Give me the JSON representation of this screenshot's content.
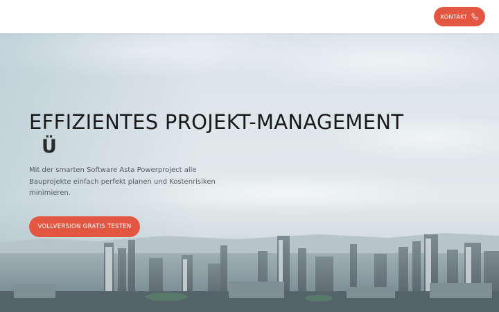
{
  "header": {
    "contact_label": "KONTAKT",
    "contact_icon": "phone-icon",
    "accent_color": "#e35641"
  },
  "hero": {
    "title": "EFFIZIENTES PROJEKT-MANAGEMENT",
    "glyph": "Ü",
    "description": "Mit der smarten Software Asta Powerproject alle Bauprojekte einfach perfekt planen und Kostenrisiken minimieren.",
    "cta_label": "VOLLVERSION GRATIS TESTEN",
    "background": "city-skyline-image"
  }
}
